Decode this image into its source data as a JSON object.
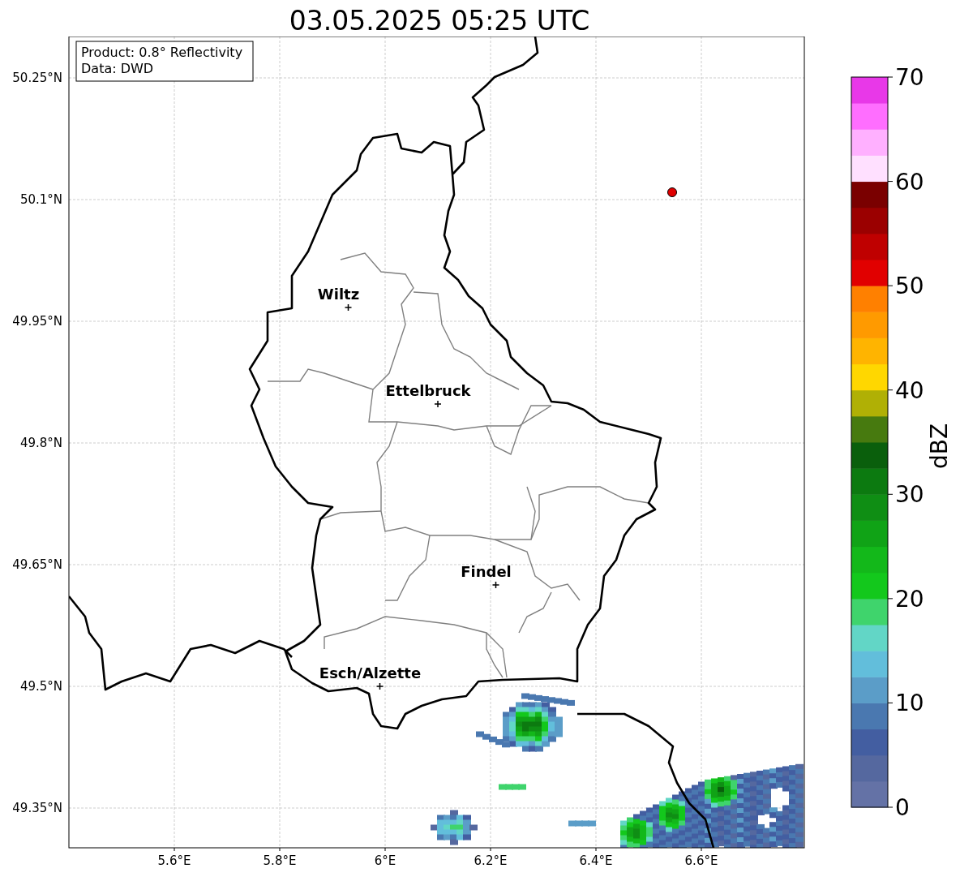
{
  "title": "03.05.2025 05:25 UTC",
  "info_box": [
    "Product: 0.8° Reflectivity",
    "Data: DWD"
  ],
  "x_ticks": [
    "5.6°E",
    "5.8°E",
    "6°E",
    "6.2°E",
    "6.4°E",
    "6.6°E"
  ],
  "y_ticks": [
    "50.25°N",
    "50.1°N",
    "49.95°N",
    "49.8°N",
    "49.65°N",
    "49.5°N",
    "49.35°N"
  ],
  "cities": [
    {
      "name": "Wiltz"
    },
    {
      "name": "Ettelbruck"
    },
    {
      "name": "Findel"
    },
    {
      "name": "Esch/Alzette"
    }
  ],
  "colorbar": {
    "label": "dBZ",
    "ticks": [
      "70",
      "60",
      "50",
      "40",
      "30",
      "20",
      "10",
      "0"
    ],
    "bins": [
      {
        "color": "#6472a6"
      },
      {
        "color": "#55689f"
      },
      {
        "color": "#435ea1"
      },
      {
        "color": "#4a78b0"
      },
      {
        "color": "#5b9dc8"
      },
      {
        "color": "#62bedb"
      },
      {
        "color": "#62d6c6"
      },
      {
        "color": "#3fd46c"
      },
      {
        "color": "#13c81c"
      },
      {
        "color": "#13b81a"
      },
      {
        "color": "#10a316"
      },
      {
        "color": "#0f8e14"
      },
      {
        "color": "#0c7a10"
      },
      {
        "color": "#0a5f0c"
      },
      {
        "color": "#477a0f"
      },
      {
        "color": "#b0b005"
      },
      {
        "color": "#ffd700"
      },
      {
        "color": "#ffb400"
      },
      {
        "color": "#ff9a00"
      },
      {
        "color": "#ff8000"
      },
      {
        "color": "#e10000"
      },
      {
        "color": "#bf0000"
      },
      {
        "color": "#9b0000"
      },
      {
        "color": "#7a0000"
      },
      {
        "color": "#ffe0ff"
      },
      {
        "color": "#ffb0ff"
      },
      {
        "color": "#ff6eff"
      },
      {
        "color": "#e838e8"
      }
    ]
  }
}
